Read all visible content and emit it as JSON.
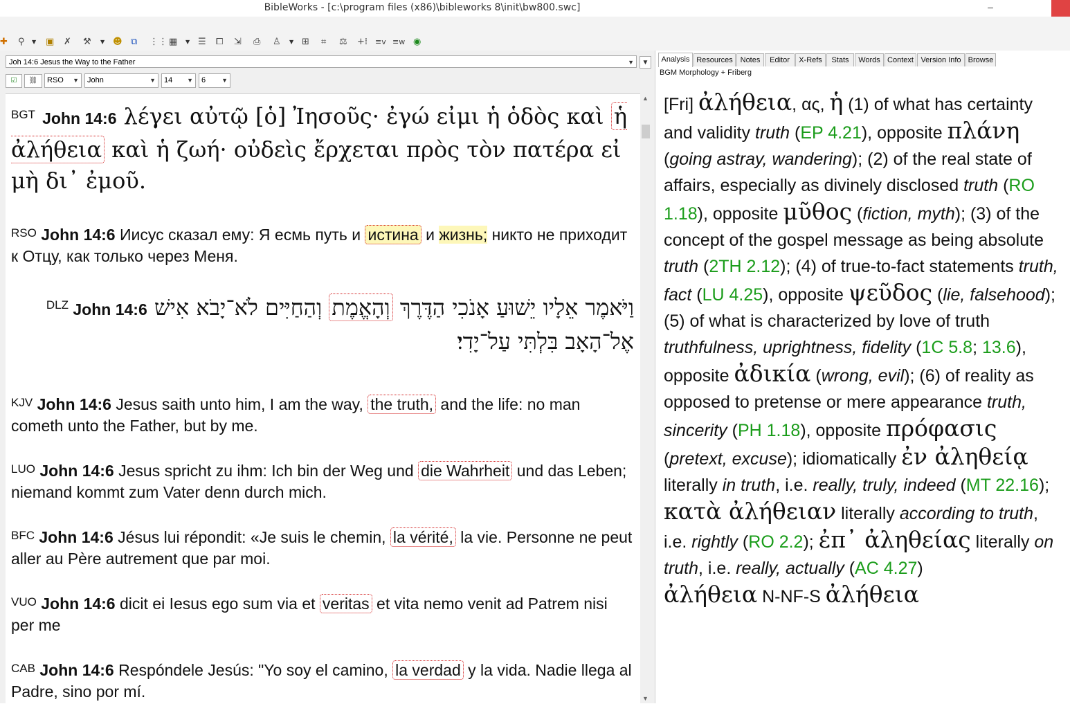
{
  "window": {
    "title": "BibleWorks - [c:\\program files (x86)\\bibleworks 8\\init\\bw800.swc]",
    "minimize_symbol": "–"
  },
  "toolbar_icons": [
    "plus-icon",
    "search-tools-icon",
    "copy-icon",
    "gear-wrench-icon",
    "tools-icon",
    "person-icon",
    "window-icon",
    "parallel-icon",
    "grid-icon",
    "list-icon",
    "copy-pages-icon",
    "export-icon",
    "print-icon",
    "person2-icon",
    "resize-icon",
    "table-icon",
    "hammer-icon",
    "plus-split-icon",
    "word-ev-icon",
    "word-bw-icon",
    "globe-icon"
  ],
  "left": {
    "verse_reference": "Joh 14:6 Jesus the Way to the Father",
    "version_select": "RSO",
    "book_select": "John",
    "chapter_select": "14",
    "verse_select": "6",
    "verses": {
      "bgt": {
        "version": "BGT",
        "ref": "John 14:6",
        "pre": " λέγει αὐτῷ [ὁ] Ἰησοῦς· ἐγώ εἰμι ἡ ὁδὸς καὶ ",
        "hl": "ἡ ἀλήθεια",
        "post": " καὶ ἡ ζωή· οὐδεὶς ἔρχεται πρὸς τὸν πατέρα εἰ μὴ δι᾽ ἐμοῦ."
      },
      "rso": {
        "version": "RSO",
        "ref": "John 14:6",
        "pre": " Иисус сказал ему: Я есмь путь и ",
        "hl": "истина",
        "mid": " и ",
        "hl2": "жизнь;",
        "post": " никто не приходит к Отцу, как только через Меня."
      },
      "dlz": {
        "version": "DLZ",
        "ref": "John 14:6",
        "pre": "וַיֹּאמֶר אֵלָיו יֵשׁוּעַ אָנֹכִי הַדֶּרֶךְ ",
        "hl": "וְהָאֱמֶת",
        "post": " וְהַחַיִּים לֹא־יָבֹא אִישׁ אֶל־הָאָב בִּלְתִּי עַל־יָדִי׃"
      },
      "kjv": {
        "version": "KJV",
        "ref": "John 14:6",
        "pre": " Jesus saith unto him, I am the way, ",
        "hl": "the truth,",
        "post": " and the life: no man cometh unto the Father, but by me."
      },
      "luo": {
        "version": "LUO",
        "ref": "John 14:6",
        "pre": " Jesus spricht zu ihm: Ich bin der Weg und ",
        "hl": "die Wahrheit",
        "post": " und das Leben; niemand kommt zum Vater denn durch mich."
      },
      "bfc": {
        "version": "BFC",
        "ref": "John 14:6",
        "pre": " Jésus lui répondit: «Je suis le chemin, ",
        "hl": "la vérité,",
        "post": " la vie. Personne ne peut aller au Père autrement que par moi."
      },
      "vuo": {
        "version": "VUO",
        "ref": "John 14:6",
        "pre": " dicit ei Iesus ego sum via et ",
        "hl": "veritas",
        "post": " et vita nemo venit ad Patrem nisi per me"
      },
      "cab": {
        "version": "CAB",
        "ref": "John 14:6",
        "pre": " Respóndele Jesús: \"Yo soy el camino, ",
        "hl": "la verdad",
        "post": " y la vida. Nadie llega al Padre, sino por mí."
      }
    }
  },
  "right": {
    "tabs": [
      "Analysis",
      "Resources",
      "Notes",
      "Editor",
      "X-Refs",
      "Stats",
      "Words",
      "Context",
      "Version Info",
      "Browse"
    ],
    "morph_label": "BGM Morphology + Friberg",
    "analysis": {
      "f1": "[Fri] ",
      "g1": "ἀλήθεια",
      "f2": ", ας, ",
      "g2": "ἡ",
      "f3": " (1) of what has certainty and validity ",
      "i1": "truth",
      "f4": " (",
      "r1": "EP 4.21",
      "f5": "), opposite ",
      "g3": "πλάνη",
      "f6": " (",
      "i2": "going astray, wandering",
      "f7": "); (2) of the real state of affairs, especially as divinely disclosed ",
      "i3": "truth",
      "f8": " (",
      "r2": "RO 1.18",
      "f9": "), opposite ",
      "g4": "μῦθος",
      "f10": " (",
      "i4": "fiction, myth",
      "f11": "); (3) of the concept of the gospel message as being absolute ",
      "i5": "truth",
      "f12": " (",
      "r3": "2TH 2.12",
      "f13": "); (4) of true-to-fact statements ",
      "i6": "truth, fact",
      "f14": " (",
      "r4": "LU 4.25",
      "f15": "), opposite ",
      "g5": "ψεῦδος",
      "f16": " (",
      "i7": "lie, falsehood",
      "f17": "); (5) of what is characterized by love of truth ",
      "i8": "truthfulness, uprightness, fidelity",
      "f18": " (",
      "r5": "1C 5.8",
      "f19": "; ",
      "r6": "13.6",
      "f20": "), opposite ",
      "g6": "ἀδικία",
      "f21": " (",
      "i9": "wrong, evil",
      "f22": "); (6) of reality as opposed to pretense or mere appearance ",
      "i10": "truth, sincerity",
      "f23": " (",
      "r7": "PH 1.18",
      "f24": "), opposite ",
      "g7": "πρόφασις",
      "f25": " (",
      "i11": "pretext, excuse",
      "f26": "); idiomatically ",
      "g8": "ἐν ἀληθείᾳ",
      "f27": " literally ",
      "i12": "in truth",
      "f28": ", i.e. ",
      "i13": "really, truly, indeed",
      "f29": " (",
      "r8": "MT 22.16",
      "f30": "); ",
      "g9": "κατὰ ἀλήθειαν",
      "f31": " literally ",
      "i14": "according to truth",
      "f32": ", i.e. ",
      "i15": "rightly",
      "f33": " (",
      "r9": "RO 2.2",
      "f34": "); ",
      "g10": "ἐπ᾽ ἀληθείας",
      "f35": " literally ",
      "i16": "on truth",
      "f36": ", i.e. ",
      "i17": "really, actually",
      "f37": " (",
      "r10": "AC 4.27",
      "f38": ")",
      "g11": "ἀλήθεια",
      "parse": " N-NF-S ",
      "g12": "ἀλήθεια"
    }
  }
}
